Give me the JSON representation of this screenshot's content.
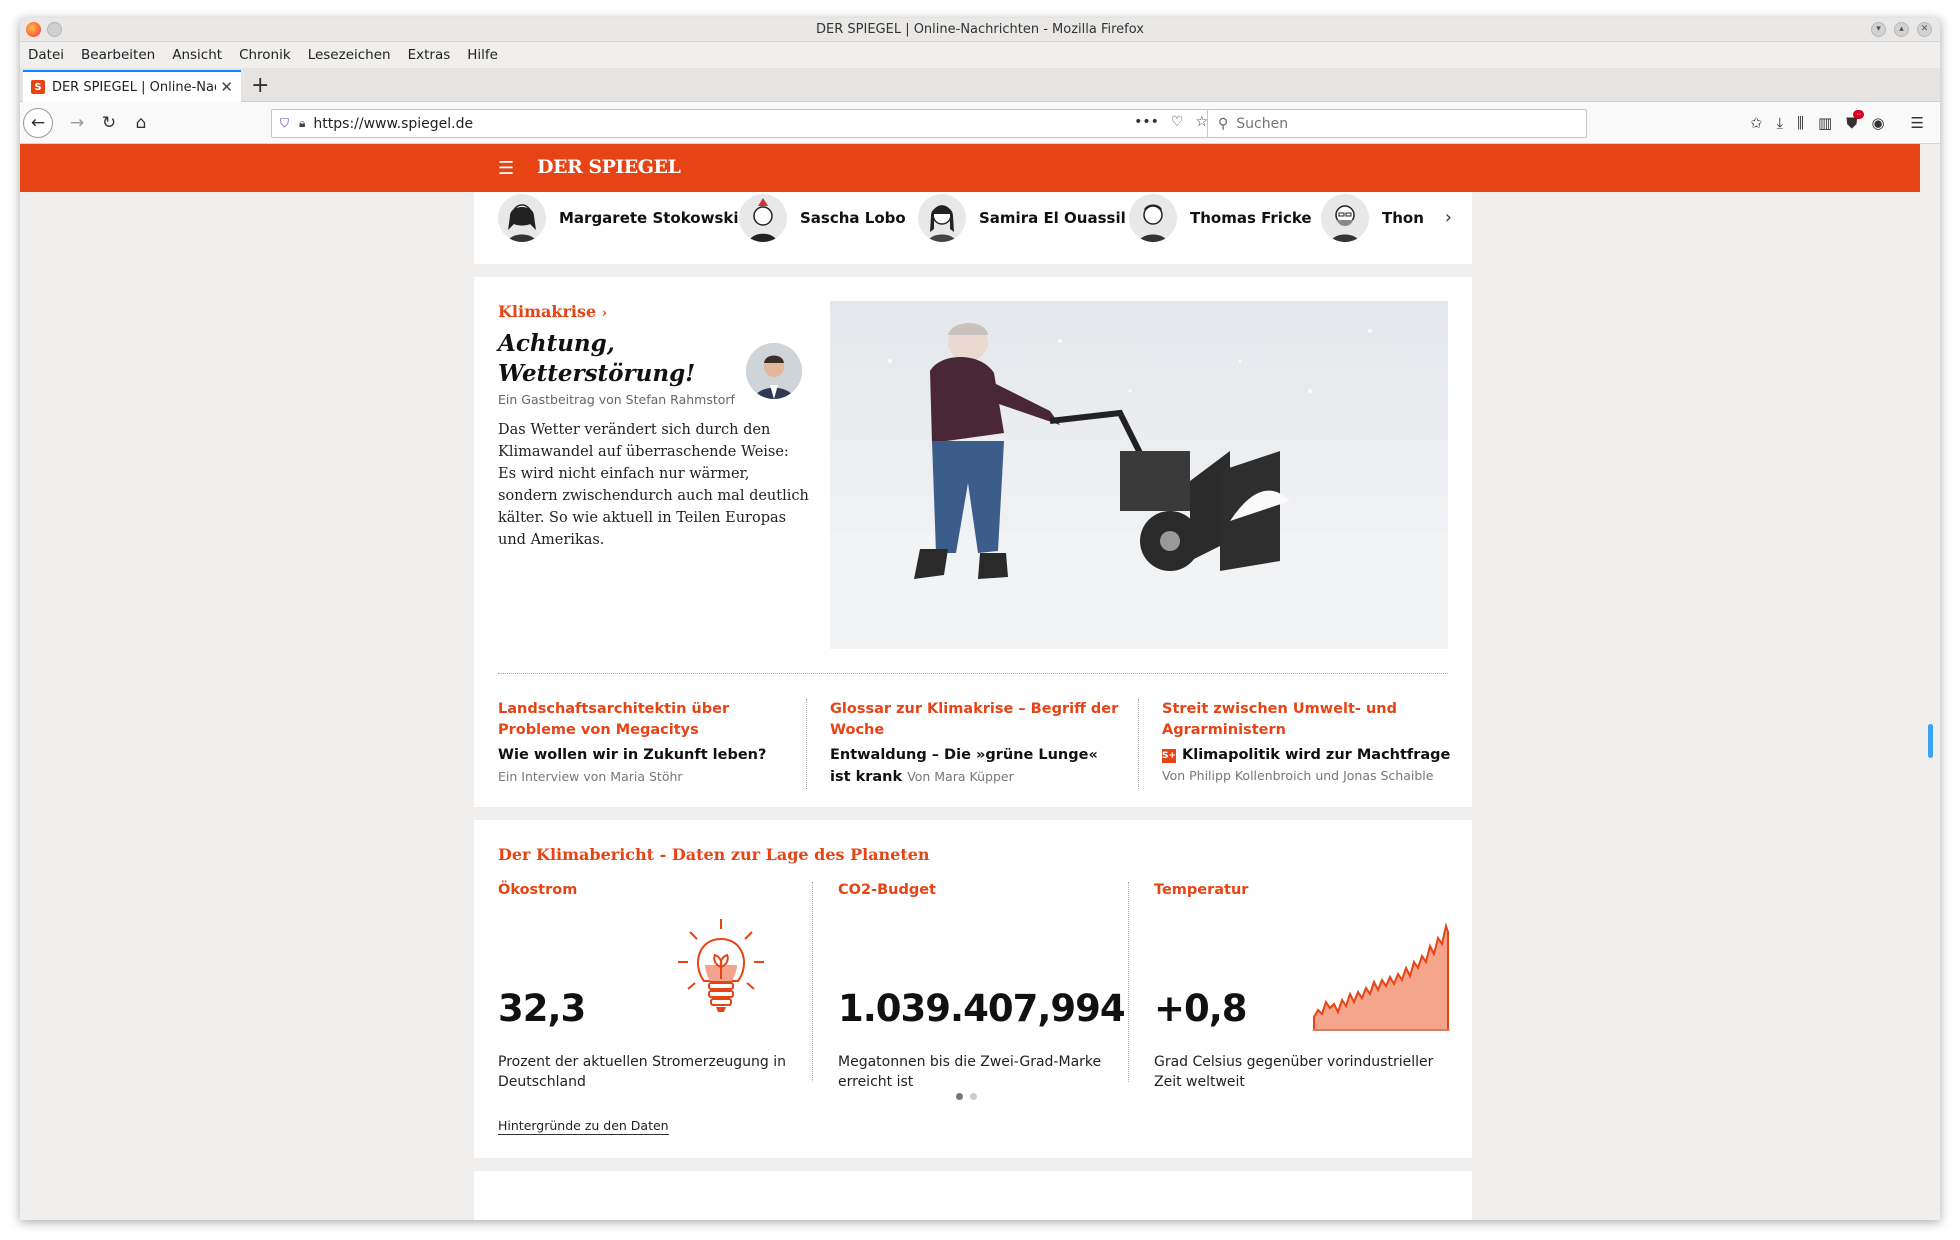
{
  "window": {
    "title": "DER SPIEGEL | Online-Nachrichten - Mozilla Firefox"
  },
  "menu": [
    "Datei",
    "Bearbeiten",
    "Ansicht",
    "Chronik",
    "Lesezeichen",
    "Extras",
    "Hilfe"
  ],
  "tab": {
    "label": "DER SPIEGEL | Online-Nac",
    "favicon": "S"
  },
  "urlbar": {
    "url": "https://www.spiegel.de"
  },
  "search": {
    "placeholder": "Suchen"
  },
  "site": {
    "logo": "DER SPIEGEL",
    "accent": "#e64415"
  },
  "authors": [
    "Margarete Stokowski",
    "Sascha Lobo",
    "Samira El Ouassil",
    "Thomas Fricke",
    "Thon"
  ],
  "feature": {
    "kicker": "Klimakrise",
    "headline": "Achtung, Wetterstörung!",
    "byline": "Ein Gastbeitrag von Stefan Rahmstorf",
    "teaser": "Das Wetter verändert sich durch den Klimawandel auf überraschende Weise: Es wird nicht einfach nur wärmer, sondern zwischendurch auch mal deutlich kälter. So wie aktuell in Teilen Europas und Amerikas."
  },
  "subs": [
    {
      "kicker": "Landschaftsarchitektin über Probleme von Megacitys",
      "headline": "Wie wollen wir in Zukunft leben?",
      "meta": "Ein Interview von Maria Stöhr"
    },
    {
      "kicker": "Glossar zur Klimakrise – Begriff der Woche",
      "headline": "Entwaldung – Die »grüne Lunge« ist krank",
      "meta": "Von Mara Küpper"
    },
    {
      "kicker": "Streit zwischen Umwelt- und Agrarministern",
      "badge": "S+",
      "headline": "Klimapolitik wird zur Machtfrage",
      "meta": "Von Philipp Kollenbroich und Jonas Schaible"
    }
  ],
  "klimabericht": {
    "title": "Der Klimabericht - Daten zur Lage des Planeten",
    "columns": [
      {
        "title": "Ökostrom",
        "value": "32,3",
        "desc": "Prozent der aktuellen Stromerzeugung in Deutschland",
        "icon": "lightbulb-icon"
      },
      {
        "title": "CO2-Budget",
        "value": "1.039.407,994",
        "desc": "Megatonnen bis die Zwei-Grad-Marke erreicht ist"
      },
      {
        "title": "Temperatur",
        "value": "+0,8",
        "desc": "Grad Celsius gegenüber vorindustrieller Zeit weltweit",
        "icon": "temperature-chart-icon"
      }
    ],
    "link": "Hintergründe zu den Daten"
  }
}
